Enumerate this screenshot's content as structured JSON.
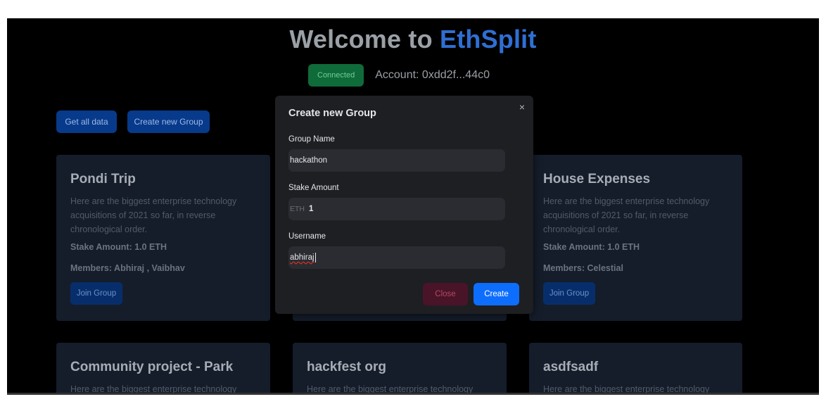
{
  "header": {
    "title_prefix": "Welcome to",
    "title_brand": "EthSplit",
    "status_badge": "Connected",
    "account": "Account: 0xdd2f...44c0"
  },
  "actions": {
    "get_all_data": "Get all data",
    "create_new_group": "Create new Group"
  },
  "groups": [
    {
      "name": "Pondi Trip",
      "description": "Here are the biggest enterprise technology acquisitions of 2021 so far, in reverse chronological order.",
      "stake": "Stake Amount: 1.0 ETH",
      "members": "Members: Abhiraj , Vaibhav",
      "join": "Join Group"
    },
    {
      "name": "House Expenses",
      "description": "Here are the biggest enterprise technology acquisitions of 2021 so far, in reverse chronological order.",
      "stake": "Stake Amount: 1.0 ETH",
      "members": "Members: Celestial",
      "join": "Join Group"
    },
    {
      "name": "Community project - Park",
      "description": "Here are the biggest enterprise technology"
    },
    {
      "name": "hackfest org",
      "description": "Here are the biggest enterprise technology"
    },
    {
      "name": "asdfsadf",
      "description": "Here are the biggest enterprise technology"
    }
  ],
  "modal": {
    "title": "Create new Group",
    "close_icon": "×",
    "group_name_label": "Group Name",
    "group_name_value": "hackathon",
    "stake_label": "Stake Amount",
    "stake_prefix": "ETH",
    "stake_value": "1",
    "username_label": "Username",
    "username_value": "abhiraj",
    "close_button": "Close",
    "create_button": "Create"
  },
  "colors": {
    "brand": "#2f6fd3",
    "connected": "#0f6b3a",
    "primary_button": "#0d6efd",
    "danger_button": "#4a1428",
    "card_bg": "#151d2b"
  }
}
